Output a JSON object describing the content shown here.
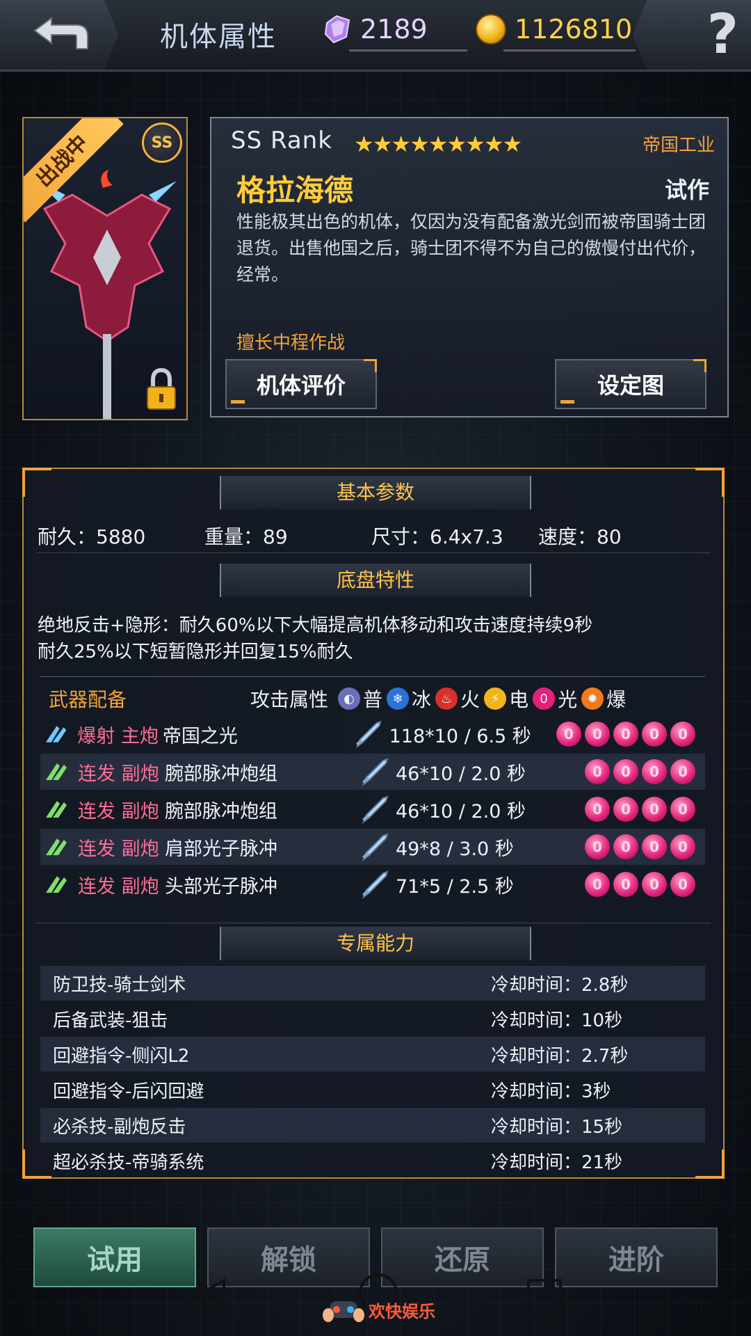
{
  "header": {
    "title": "机体属性",
    "gems": "2189",
    "coins": "1126810",
    "help_symbol": "?"
  },
  "mech": {
    "battle_ribbon": "出战中",
    "rank_badge": "SS",
    "rank_text": "SS  Rank",
    "stars": "★★★★★★★★★",
    "faction": "帝国工业",
    "name": "格拉海德",
    "tag": "试作",
    "description": "性能极其出色的机体，仅因为没有配备激光剑而被帝国骑士团退货。出售他国之后，骑士团不得不为自己的傲慢付出代价，经常。",
    "specialty": "擅长中程作战",
    "review_button": "机体评价",
    "art_button": "设定图"
  },
  "basic": {
    "heading": "基本参数",
    "durability": "耐久：5880",
    "weight": "重量：89",
    "size": "尺寸：6.4x7.3",
    "speed": "速度：80"
  },
  "chassis": {
    "heading": "底盘特性",
    "line1": "绝地反击+隐形：耐久60%以下大幅提高机体移动和攻击速度持续9秒",
    "line2": "耐久25%以下短暂隐形并回复15%耐久"
  },
  "weapons": {
    "heading": "武器配备",
    "attack_label": "攻击属性",
    "elements": [
      {
        "label": "普",
        "color": "#6b6fb8"
      },
      {
        "label": "冰",
        "color": "#2a73d9"
      },
      {
        "label": "火",
        "color": "#d9302a"
      },
      {
        "label": "电",
        "color": "#f0b51a"
      },
      {
        "label": "光",
        "color": "#e2217b"
      },
      {
        "label": "爆",
        "color": "#f27a1a"
      }
    ],
    "rows": [
      {
        "type": "爆射 主炮",
        "name": "帝国之光",
        "damage": "118*10 / 6.5 秒",
        "orbs": 5
      },
      {
        "type": "连发 副炮",
        "name": "腕部脉冲炮组",
        "damage": "46*10 / 2.0 秒",
        "orbs": 4
      },
      {
        "type": "连发 副炮",
        "name": "腕部脉冲炮组",
        "damage": "46*10 / 2.0 秒",
        "orbs": 4
      },
      {
        "type": "连发 副炮",
        "name": "肩部光子脉冲",
        "damage": "49*8 / 3.0 秒",
        "orbs": 4
      },
      {
        "type": "连发 副炮",
        "name": "头部光子脉冲",
        "damage": "71*5 / 2.5 秒",
        "orbs": 4
      }
    ]
  },
  "skills": {
    "heading": "专属能力",
    "rows": [
      {
        "name": "防卫技-骑士剑术",
        "cooldown": "冷却时间：2.8秒"
      },
      {
        "name": "后备武装-狙击",
        "cooldown": "冷却时间：10秒"
      },
      {
        "name": "回避指令-侧闪L2",
        "cooldown": "冷却时间：2.7秒"
      },
      {
        "name": "回避指令-后闪回避",
        "cooldown": "冷却时间：3秒"
      },
      {
        "name": "必杀技-副炮反击",
        "cooldown": "冷却时间：15秒"
      },
      {
        "name": "超必杀技-帝骑系统",
        "cooldown": "冷却时间：21秒"
      }
    ]
  },
  "bottom": {
    "try": "试用",
    "unlock": "解锁",
    "restore": "还原",
    "advance": "进阶"
  },
  "watermark": "欢快娱乐"
}
